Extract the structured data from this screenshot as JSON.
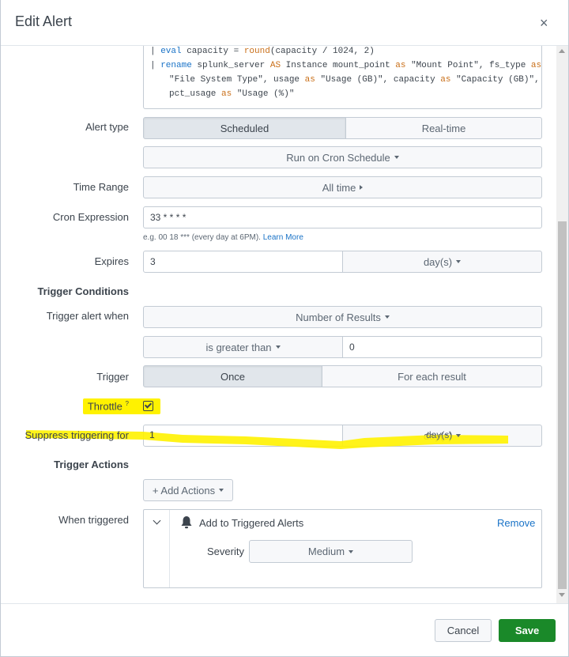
{
  "dialog": {
    "title": "Edit Alert",
    "close_glyph": "×"
  },
  "search": {
    "line1_pipe": "| ",
    "line1_cmd": "eval",
    "line1_a": " capacity = ",
    "line1_fn": "round",
    "line1_b": "(capacity / 1024, 2)",
    "line2_pipe": "| ",
    "line2_cmd": "rename",
    "line2_a": " splunk_server ",
    "line2_as1": "AS",
    "line2_b": " Instance mount_point ",
    "line2_as2": "as",
    "line2_c": " \"Mount Point\", fs_type ",
    "line2_as3": "as",
    "line3_a": "\"File System Type\", usage ",
    "line3_as1": "as",
    "line3_b": " \"Usage (GB)\", capacity ",
    "line3_as2": "as",
    "line3_c": " \"Capacity (GB)\",",
    "line4_a": "pct_usage ",
    "line4_as": "as",
    "line4_b": " \"Usage (%)\""
  },
  "alert_type": {
    "label": "Alert type",
    "options": [
      "Scheduled",
      "Real-time"
    ],
    "selected": "Scheduled",
    "schedule_button": "Run on Cron Schedule"
  },
  "time_range": {
    "label": "Time Range",
    "value": "All time"
  },
  "cron": {
    "label": "Cron Expression",
    "value": "33 * * * *",
    "help_text": "e.g. 00 18 *** (every day at 6PM).",
    "help_link": "Learn More"
  },
  "expires": {
    "label": "Expires",
    "value": "3",
    "unit": "day(s)"
  },
  "trigger_conditions": {
    "heading": "Trigger Conditions",
    "when_label": "Trigger alert when",
    "when_value": "Number of Results",
    "comparator": "is greater than",
    "threshold": "0",
    "trigger_label": "Trigger",
    "trigger_options": [
      "Once",
      "For each result"
    ],
    "trigger_selected": "Once",
    "throttle_label": "Throttle",
    "throttle_help": "?",
    "throttle_checked": true,
    "suppress_label": "Suppress triggering for",
    "suppress_value": "1",
    "suppress_unit": "day(s)"
  },
  "trigger_actions": {
    "heading": "Trigger Actions",
    "add_button": "+ Add Actions",
    "when_triggered_label": "When triggered",
    "action_name": "Add to Triggered Alerts",
    "remove_link": "Remove",
    "severity_label": "Severity",
    "severity_value": "Medium"
  },
  "footer": {
    "cancel": "Cancel",
    "save": "Save"
  },
  "colors": {
    "highlight": "#fff200",
    "save_green": "#1a8929",
    "link_blue": "#1a73c7",
    "keyword_blue": "#1a73c7",
    "function_orange": "#c96f19"
  }
}
